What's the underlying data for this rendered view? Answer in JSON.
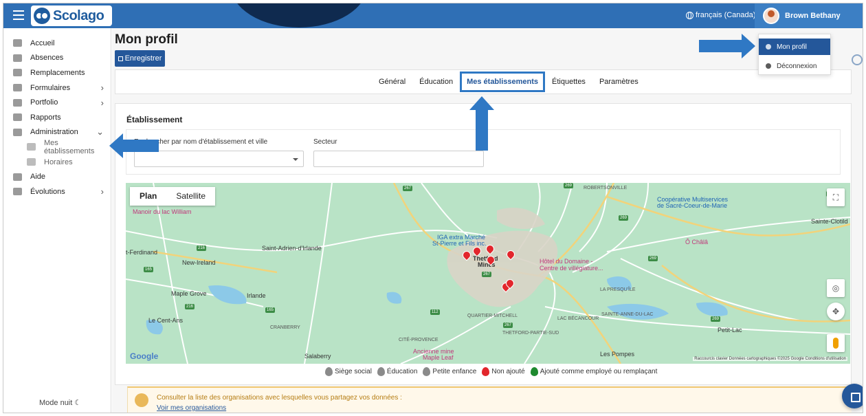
{
  "header": {
    "brand": "Scolago",
    "language": "français (Canada)",
    "user_name": "Brown Bethany"
  },
  "sidebar": {
    "items": [
      {
        "label": "Accueil",
        "icon": "home-icon"
      },
      {
        "label": "Absences",
        "icon": "users-icon"
      },
      {
        "label": "Remplacements",
        "icon": "swap-icon"
      },
      {
        "label": "Formulaires",
        "icon": "form-icon",
        "chevron": ">"
      },
      {
        "label": "Portfolio",
        "icon": "trophy-icon",
        "chevron": ">"
      },
      {
        "label": "Rapports",
        "icon": "report-icon"
      },
      {
        "label": "Administration",
        "icon": "gear-icon",
        "chevron": "v"
      },
      {
        "label": "Mes établissements",
        "icon": "building-icon",
        "sub": true
      },
      {
        "label": "Horaires",
        "icon": "calendar-icon",
        "sub": true
      },
      {
        "label": "Aide",
        "icon": "question-icon"
      },
      {
        "label": "Évolutions",
        "icon": "sprout-icon",
        "chevron": ">"
      }
    ],
    "night_mode": "Mode nuit ☾"
  },
  "page": {
    "title": "Mon profil",
    "save_label": "Enregistrer",
    "tabs": [
      "Général",
      "Éducation",
      "Mes établissements",
      "Étiquettes",
      "Paramètres"
    ],
    "active_tab": "Mes établissements"
  },
  "establishment": {
    "heading": "Établissement",
    "search_label": "Rechercher par nom d'établissement et ville",
    "sector_label": "Secteur"
  },
  "map": {
    "map_type_plan": "Plan",
    "map_type_satellite": "Satellite",
    "labels": {
      "manoir": "Manoir du lac William",
      "ferdinand": "t-Ferdinand",
      "saint_adrien": "Saint-Adrien-d'Irlande",
      "new_ireland": "New-Ireland",
      "maple_grove": "Maple Grove",
      "irlande": "Irlande",
      "le_cent_ans": "Le Cent-Ans",
      "cranberry": "CRANBERRY",
      "igaextra": "IGA extra Marché",
      "igaextra2": "St-Pierre et Fils inc.",
      "thetford": "Thetford",
      "mines": "Mines",
      "hotel": "Hôtel du Domaine -",
      "hotel2": "Centre de villégiature...",
      "quartier": "QUARTIER-MITCHELL",
      "cite_provence": "CITÉ-PROVENCE",
      "ancienne_mine": "Ancienne mine",
      "maple_leaf": "Maple Leaf",
      "salaberry": "Salaberry",
      "thetford_partie_sud": "THETFORD-PARTIE-SUD",
      "les_pompes": "Les Pompes",
      "lac_becancour": "LAC BÉCANCOUR",
      "saint_anne": "SAINTE-ANNE-DU-LAC",
      "petit_lac": "Petit-Lac",
      "la_presquile": "LA PRESQU'ÎLE",
      "robertsonville": "ROBERTSONVILLE",
      "cooperative": "Coopérative Multiservices",
      "cooperative2": "de Sacré-Coeur-de-Marie",
      "o_chala": "Ô Châlâ",
      "sainte_clotilde": "Sainte-Clotild"
    },
    "road_shields": [
      "267",
      "269",
      "216",
      "165",
      "216",
      "165",
      "112",
      "267",
      "267",
      "269",
      "269",
      "269",
      "267"
    ],
    "google": "Google",
    "attribution": "Raccourcis clavier   Données cartographiques ©2025 Google   Conditions d'utilisation"
  },
  "legend": [
    {
      "label": "Siège social",
      "color": "#8a8a8a"
    },
    {
      "label": "Éducation",
      "color": "#8a8a8a"
    },
    {
      "label": "Petite enfance",
      "color": "#8a8a8a"
    },
    {
      "label": "Non ajouté",
      "color": "#e2262c"
    },
    {
      "label": "Ajouté comme employé ou remplaçant",
      "color": "#1f8a2f"
    }
  ],
  "notice": {
    "text": "Consulter la liste des organisations avec lesquelles vous partagez vos données :",
    "link": "Voir mes organisations"
  },
  "user_menu": {
    "profile": "Mon profil",
    "logout": "Déconnexion"
  }
}
